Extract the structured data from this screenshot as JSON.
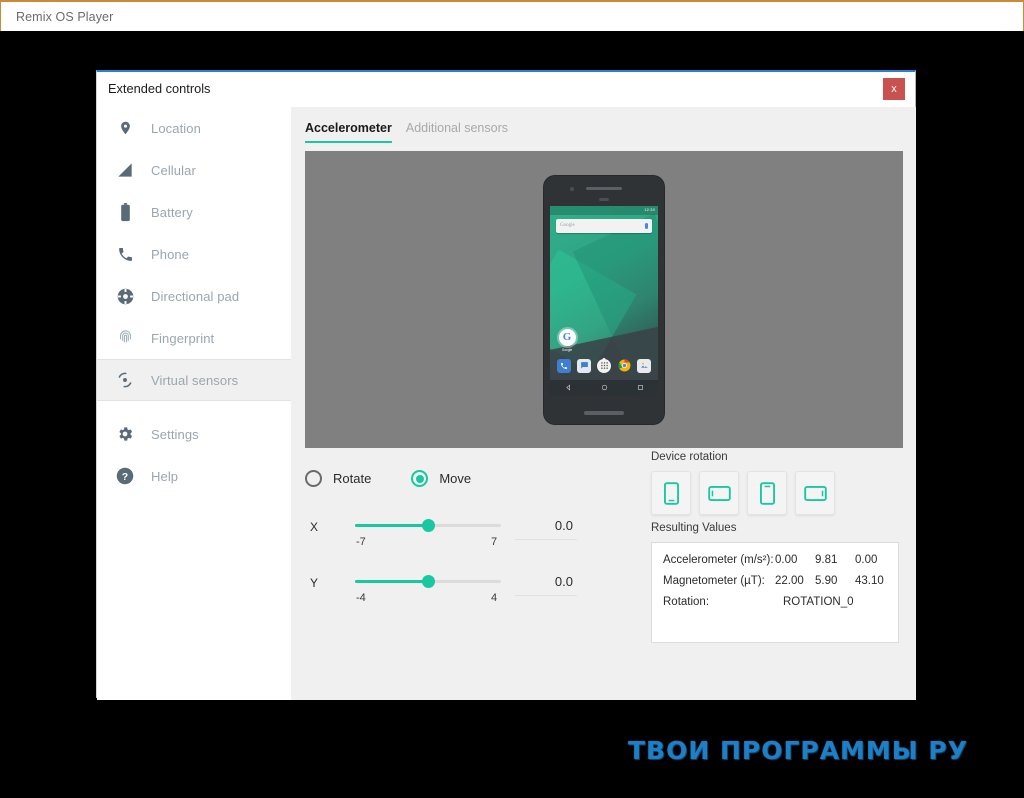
{
  "host": {
    "title": "Remix OS Player"
  },
  "dialog": {
    "title": "Extended controls",
    "close_label": "x"
  },
  "sidebar": {
    "items": [
      {
        "label": "Location",
        "icon": "location-pin-icon",
        "active": false
      },
      {
        "label": "Cellular",
        "icon": "signal-bars-icon",
        "active": false
      },
      {
        "label": "Battery",
        "icon": "battery-icon",
        "active": false
      },
      {
        "label": "Phone",
        "icon": "phone-handset-icon",
        "active": false
      },
      {
        "label": "Directional pad",
        "icon": "dpad-icon",
        "active": false
      },
      {
        "label": "Fingerprint",
        "icon": "fingerprint-icon",
        "active": false
      },
      {
        "label": "Virtual sensors",
        "icon": "virtual-sensors-icon",
        "active": true
      },
      {
        "label": "Settings",
        "icon": "gear-icon",
        "active": false
      },
      {
        "label": "Help",
        "icon": "question-mark-icon",
        "active": false
      }
    ]
  },
  "main": {
    "tabs": [
      {
        "label": "Accelerometer",
        "active": true
      },
      {
        "label": "Additional sensors",
        "active": false
      }
    ],
    "phone_preview": {
      "status_time": "12:30",
      "search_placeholder": "Google",
      "folder_label": "Google",
      "dock_icons": [
        "phone-icon",
        "messages-icon",
        "app-drawer-icon",
        "chrome-icon",
        "photos-icon"
      ],
      "nav_icons": [
        "back-icon",
        "home-icon",
        "recents-icon"
      ]
    },
    "mode": {
      "rotate_label": "Rotate",
      "move_label": "Move",
      "selected": "Move"
    },
    "sliders": [
      {
        "axis": "X",
        "min": "-7",
        "max": "7",
        "value": "0.0",
        "percent": 50
      },
      {
        "axis": "Y",
        "min": "-4",
        "max": "4",
        "value": "0.0",
        "percent": 50
      }
    ],
    "rotation": {
      "label": "Device rotation",
      "buttons": [
        {
          "name": "rotation-portrait-button",
          "orientation": "portrait"
        },
        {
          "name": "rotation-landscape-left-button",
          "orientation": "landscape"
        },
        {
          "name": "rotation-portrait-upsidedown-button",
          "orientation": "portrait"
        },
        {
          "name": "rotation-landscape-right-button",
          "orientation": "landscape"
        }
      ]
    },
    "results": {
      "label": "Resulting Values",
      "rows": [
        {
          "name": "Accelerometer (m/s²):",
          "v1": "0.00",
          "v2": "9.81",
          "v3": "0.00"
        },
        {
          "name": "Magnetometer (µT):",
          "v1": "22.00",
          "v2": "5.90",
          "v3": "43.10"
        }
      ],
      "rotation_name": "Rotation:",
      "rotation_value": "ROTATION_0"
    }
  },
  "watermark": {
    "text": "ТВОИ ПРОГРАММЫ РУ"
  },
  "colors": {
    "accent": "#19c7a0",
    "dialog_border_top": "#2a7fd4",
    "close_button": "#c9514f",
    "host_border": "#c98b3a"
  }
}
